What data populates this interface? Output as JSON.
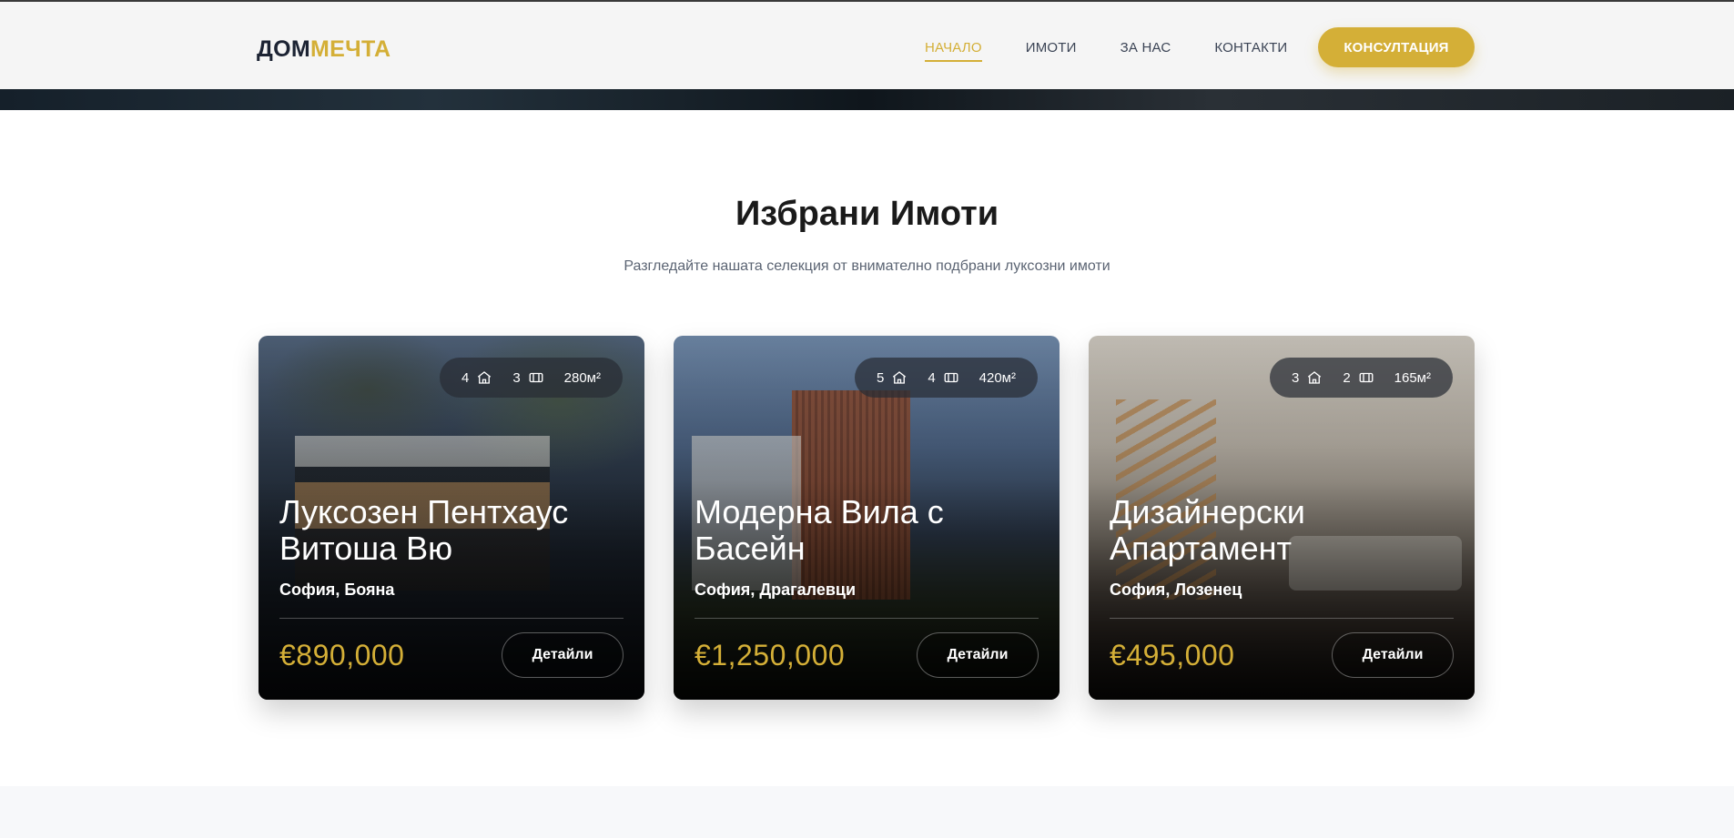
{
  "header": {
    "logo_part1": "ДОМ",
    "logo_part2": "МЕЧТА",
    "nav": [
      {
        "label": "НАЧАЛО",
        "active": true
      },
      {
        "label": "ИМОТИ",
        "active": false
      },
      {
        "label": "ЗА НАС",
        "active": false
      },
      {
        "label": "КОНТАКТИ",
        "active": false
      }
    ],
    "cta_label": "КОНСУЛТАЦИЯ"
  },
  "section": {
    "title_regular": "Избрани",
    "title_bold": "Имоти",
    "subtitle": "Разгледайте нашата селекция от внимателно подбрани луксозни имоти"
  },
  "cards": [
    {
      "bedrooms": "4",
      "bathrooms": "3",
      "area": "280м²",
      "title": "Луксозен Пентхаус Витоша Вю",
      "location": "София, Бояна",
      "price": "€890,000",
      "details_label": "Детайли"
    },
    {
      "bedrooms": "5",
      "bathrooms": "4",
      "area": "420м²",
      "title": "Модерна Вила с Басейн",
      "location": "София, Драгалевци",
      "price": "€1,250,000",
      "details_label": "Детайли"
    },
    {
      "bedrooms": "3",
      "bathrooms": "2",
      "area": "165м²",
      "title": "Дизайнерски Апартамент",
      "location": "София, Лозенец",
      "price": "€495,000",
      "details_label": "Детайли"
    }
  ],
  "colors": {
    "accent": "#d4af37",
    "dark_text": "#1c2333",
    "nav_text": "#3b4455"
  },
  "icons": {
    "bedroom": "home-icon",
    "bathroom": "bath-icon"
  }
}
